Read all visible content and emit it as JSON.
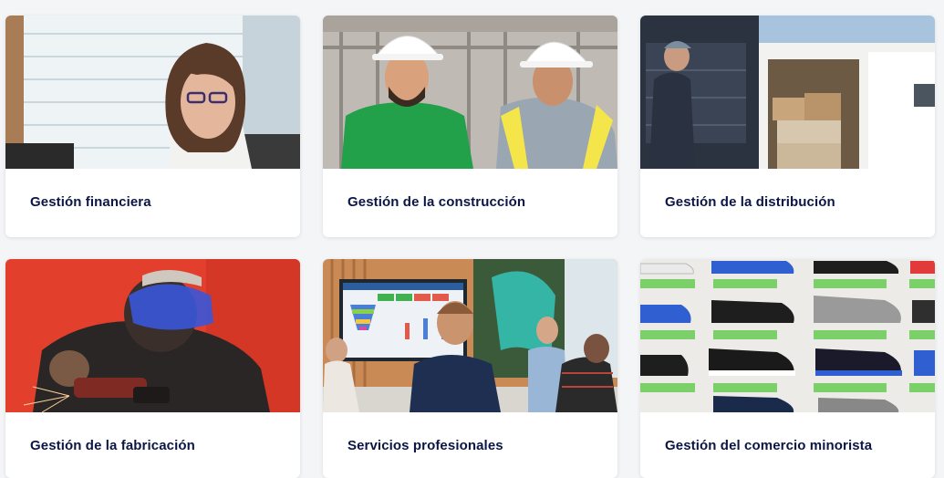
{
  "cards": [
    {
      "title": "Gestión financiera",
      "image": "woman-at-office-desk-photo"
    },
    {
      "title": "Gestión de la construcción",
      "image": "construction-workers-hardhats-photo"
    },
    {
      "title": "Gestión de la distribución",
      "image": "delivery-van-loading-photo"
    },
    {
      "title": "Gestión de la fabricación",
      "image": "welder-grinding-sparks-photo"
    },
    {
      "title": "Servicios profesionales",
      "image": "team-meeting-dashboard-photo"
    },
    {
      "title": "Gestión del comercio minorista",
      "image": "shoe-display-wall-photo"
    }
  ],
  "colors": {
    "title_text": "#0b1645",
    "card_background": "#ffffff",
    "page_background": "#f4f5f7",
    "accent_green": "#3fb24f"
  }
}
